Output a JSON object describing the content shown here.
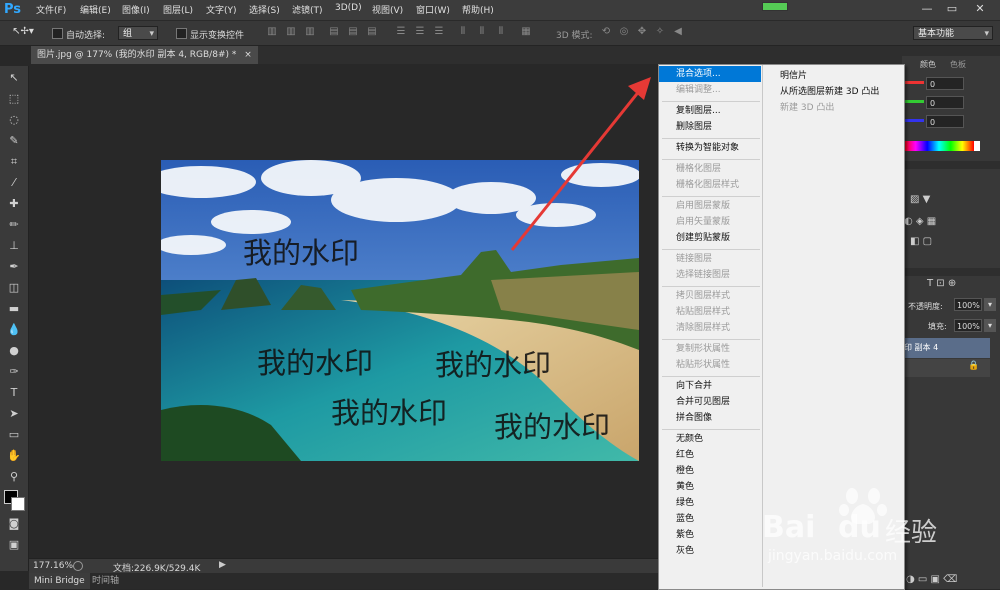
{
  "app": {
    "logo": "Ps"
  },
  "menubar": {
    "items": [
      "文件(F)",
      "编辑(E)",
      "图像(I)",
      "图层(L)",
      "文字(Y)",
      "选择(S)",
      "滤镜(T)",
      "3D(D)",
      "视图(V)",
      "窗口(W)",
      "帮助(H)"
    ],
    "window_controls": [
      "—",
      "▭",
      "✕"
    ]
  },
  "optionsbar": {
    "auto_select_label": "自动选择:",
    "auto_select_value": "组",
    "show_transform_label": "显示变换控件",
    "mode_3d_label": "3D 模式:",
    "workspace": "基本功能"
  },
  "document": {
    "tab_title": "图片.jpg @ 177% (我的水印 副本 4, RGB/8#) *",
    "tab_close": "×",
    "watermark_text": "我的水印"
  },
  "status": {
    "zoom": "177.16%",
    "doc_info": "文档:226.9K/529.4K"
  },
  "bottom_tabs": [
    "Mini Bridge",
    "时间轴"
  ],
  "context_menu": {
    "items": [
      {
        "label": "混合选项...",
        "enabled": true,
        "highlight": true
      },
      {
        "label": "编辑调整...",
        "enabled": false
      },
      {
        "sep": true
      },
      {
        "label": "复制图层...",
        "enabled": true
      },
      {
        "label": "删除图层",
        "enabled": true
      },
      {
        "sep": true
      },
      {
        "label": "转换为智能对象",
        "enabled": true
      },
      {
        "sep": true
      },
      {
        "label": "栅格化图层",
        "enabled": false
      },
      {
        "label": "栅格化图层样式",
        "enabled": false
      },
      {
        "sep": true
      },
      {
        "label": "启用图层蒙版",
        "enabled": false
      },
      {
        "label": "启用矢量蒙版",
        "enabled": false
      },
      {
        "label": "创建剪贴蒙版",
        "enabled": true
      },
      {
        "sep": true
      },
      {
        "label": "链接图层",
        "enabled": false
      },
      {
        "label": "选择链接图层",
        "enabled": false
      },
      {
        "sep": true
      },
      {
        "label": "拷贝图层样式",
        "enabled": false
      },
      {
        "label": "粘贴图层样式",
        "enabled": false
      },
      {
        "label": "清除图层样式",
        "enabled": false
      },
      {
        "sep": true
      },
      {
        "label": "复制形状属性",
        "enabled": false
      },
      {
        "label": "粘贴形状属性",
        "enabled": false
      },
      {
        "sep": true
      },
      {
        "label": "向下合并",
        "enabled": true
      },
      {
        "label": "合并可见图层",
        "enabled": true
      },
      {
        "label": "拼合图像",
        "enabled": true
      },
      {
        "sep": true
      },
      {
        "label": "无颜色",
        "enabled": true
      },
      {
        "label": "红色",
        "enabled": true
      },
      {
        "label": "橙色",
        "enabled": true
      },
      {
        "label": "黄色",
        "enabled": true
      },
      {
        "label": "绿色",
        "enabled": true
      },
      {
        "label": "蓝色",
        "enabled": true
      },
      {
        "label": "紫色",
        "enabled": true
      },
      {
        "label": "灰色",
        "enabled": true
      }
    ],
    "submenu": [
      {
        "label": "明信片",
        "enabled": true
      },
      {
        "label": "从所选图层新建 3D 凸出",
        "enabled": true
      },
      {
        "label": "新建 3D 凸出",
        "enabled": false
      }
    ]
  },
  "right_panel": {
    "color_tabs": [
      "颜色",
      "色板"
    ],
    "rgb_values": [
      "0",
      "0",
      "0"
    ],
    "opacity_label": "不透明度:",
    "opacity_value": "100%",
    "fill_label": "填充:",
    "fill_value": "100%",
    "layer_name": "印 副本 4"
  },
  "watermark_brand": {
    "brand": "Bai",
    "brand2": "du",
    "cn": "经验",
    "url": "jingyan.baidu.com"
  },
  "colors": {
    "accent": "#0078d7",
    "arrow": "#e53935",
    "panel": "#383838"
  }
}
